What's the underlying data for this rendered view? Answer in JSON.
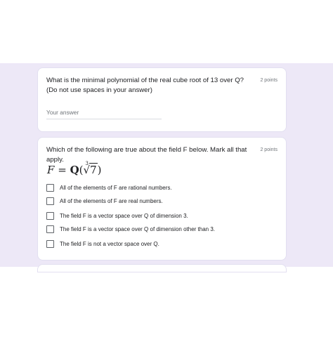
{
  "question1": {
    "text": "What is the minimal polynomial of the real cube root of 13 over Q? (Do not use spaces in your answer)",
    "points": "2 points",
    "placeholder": "Your answer"
  },
  "question2": {
    "text": "Which of the following are true about the field F below. Mark all that apply.",
    "points": "2 points",
    "formula": {
      "lhs": "F",
      "equals": "=",
      "field": "Q",
      "open": "(",
      "index": "3",
      "radicand": "7",
      "close": ")"
    },
    "options": [
      {
        "label": "All of the elements of F are rational numbers.",
        "checked": false
      },
      {
        "label": "All of the elements of F are real numbers.",
        "checked": false
      },
      {
        "label": "The field F is a vector space over Q of dimension 3.",
        "checked": false
      },
      {
        "label": "The field F is a vector space over Q of dimension other than 3.",
        "checked": false
      },
      {
        "label": "The field F is not a vector space over Q.",
        "checked": false
      }
    ]
  }
}
